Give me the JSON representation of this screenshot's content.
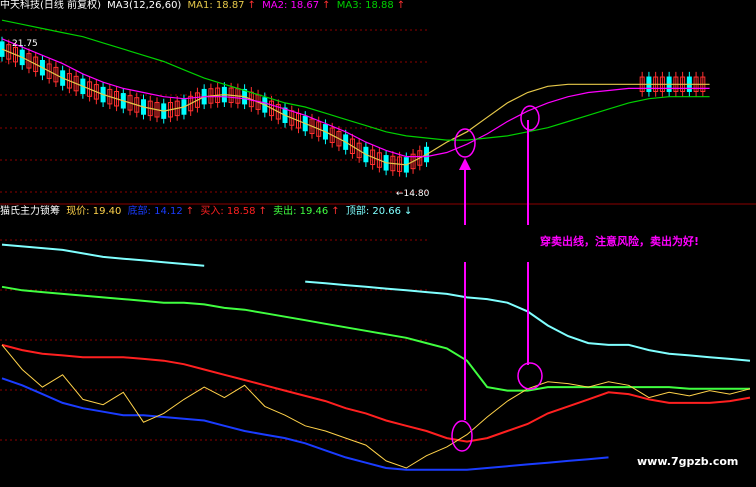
{
  "colors": {
    "bg": "#000000",
    "grid": "#8b0000",
    "up": "#ff3030",
    "down": "#00ffff",
    "ma1": "#e6c84a",
    "ma2": "#ff00ff",
    "ma3": "#00d000",
    "white": "#ffffff",
    "cyan": "#80ffff",
    "green": "#40ff40",
    "red": "#ff2020",
    "blue": "#1a3cff",
    "yellow": "#ffff40",
    "magenta": "#ff00ff",
    "orange": "#ffd24a"
  },
  "header_top": {
    "name": "中天科技(日线 前复权)",
    "ma3_label": "MA3(12,26,60)",
    "ma1": "MA1: 18.87",
    "ma2": "MA2: 18.67",
    "ma3": "MA3: 18.88",
    "arrow_up": "↑"
  },
  "header_bottom": {
    "title": "猫氏主力锁筹",
    "xianjia": "现价: 19.40",
    "dibu": "底部: 14.12",
    "mairu": "买入: 18.58",
    "maichu": "卖出: 19.46",
    "dingbu": "顶部: 20.66",
    "arrow_up": "↑",
    "arrow_down": "↓"
  },
  "annotations": {
    "high_label": "21.75",
    "low_label": "←14.80",
    "note": "穿卖出线，注意风险，卖出为好!",
    "watermark": "www.7gpzb.com"
  },
  "chart_data": [
    {
      "type": "line",
      "panel": "price",
      "x": [
        0,
        20,
        40,
        60,
        80,
        100,
        120,
        140,
        160,
        180,
        200,
        220,
        240,
        260,
        280,
        300,
        320,
        340,
        360,
        380,
        400,
        420,
        440,
        460,
        480,
        500,
        520,
        540,
        560,
        580,
        600,
        620,
        640,
        660,
        680,
        700
      ],
      "series": [
        {
          "name": "MA1",
          "values": [
            21.3,
            20.9,
            20.4,
            19.9,
            19.5,
            19.1,
            18.8,
            18.5,
            18.3,
            18.5,
            19.0,
            19.1,
            19.0,
            18.6,
            18.1,
            17.7,
            17.3,
            16.8,
            16.2,
            15.8,
            15.7,
            16.2,
            16.8,
            17.3,
            18.0,
            18.7,
            19.2,
            19.5,
            19.6,
            19.6,
            19.6,
            19.6,
            19.6,
            19.6,
            19.6,
            19.6
          ]
        },
        {
          "name": "MA2",
          "values": [
            21.8,
            21.4,
            21.0,
            20.6,
            20.1,
            19.7,
            19.4,
            19.2,
            19.0,
            18.9,
            19.0,
            19.0,
            18.9,
            18.7,
            18.4,
            18.1,
            17.7,
            17.3,
            16.8,
            16.4,
            16.1,
            16.1,
            16.3,
            16.7,
            17.2,
            17.8,
            18.3,
            18.7,
            19.0,
            19.2,
            19.3,
            19.4,
            19.4,
            19.4,
            19.4,
            19.4
          ]
        },
        {
          "name": "MA3",
          "values": [
            22.7,
            22.5,
            22.3,
            22.1,
            21.9,
            21.6,
            21.3,
            21.0,
            20.7,
            20.3,
            19.9,
            19.6,
            19.3,
            19.0,
            18.7,
            18.5,
            18.2,
            17.9,
            17.6,
            17.3,
            17.1,
            17.0,
            16.9,
            16.9,
            17.0,
            17.1,
            17.3,
            17.5,
            17.8,
            18.1,
            18.4,
            18.7,
            18.9,
            19.0,
            19.0,
            19.0
          ]
        }
      ],
      "ylim": [
        14,
        23
      ]
    },
    {
      "type": "line",
      "panel": "indicator",
      "x": [
        0,
        20,
        40,
        60,
        80,
        100,
        120,
        140,
        160,
        180,
        200,
        220,
        240,
        260,
        280,
        300,
        320,
        340,
        360,
        380,
        400,
        420,
        440,
        460,
        480,
        500,
        520,
        540,
        560,
        580,
        600,
        620,
        640,
        660,
        680,
        700,
        720,
        740
      ],
      "series": [
        {
          "name": "顶部",
          "values": [
            27.6,
            27.5,
            27.4,
            27.3,
            27.1,
            26.9,
            26.8,
            26.7,
            26.6,
            26.5,
            26.4,
            null,
            null,
            null,
            null,
            25.5,
            25.4,
            25.3,
            25.2,
            25.1,
            25.0,
            24.9,
            24.8,
            24.6,
            24.5,
            24.3,
            23.8,
            23.0,
            22.4,
            22.0,
            21.9,
            21.9,
            21.6,
            21.4,
            21.3,
            21.2,
            21.1,
            21.0
          ]
        },
        {
          "name": "卖出",
          "values": [
            25.2,
            25.0,
            24.9,
            24.8,
            24.7,
            24.6,
            24.5,
            24.4,
            24.3,
            24.3,
            24.2,
            24.0,
            23.9,
            23.7,
            23.5,
            23.3,
            23.1,
            22.9,
            22.7,
            22.5,
            22.3,
            22.0,
            21.7,
            21.0,
            19.5,
            19.3,
            19.3,
            19.5,
            19.5,
            19.5,
            19.5,
            19.5,
            19.5,
            19.5,
            19.4,
            19.4,
            19.4,
            19.4
          ]
        },
        {
          "name": "买入",
          "values": [
            21.9,
            21.6,
            21.4,
            21.3,
            21.2,
            21.2,
            21.2,
            21.1,
            21.0,
            20.8,
            20.5,
            20.2,
            19.9,
            19.6,
            19.3,
            19.0,
            18.7,
            18.3,
            18.0,
            17.6,
            17.3,
            17.0,
            16.6,
            16.4,
            16.6,
            17.0,
            17.4,
            18.0,
            18.4,
            18.8,
            19.2,
            19.1,
            18.8,
            18.6,
            18.6,
            18.6,
            18.7,
            18.9
          ]
        },
        {
          "name": "底部",
          "values": [
            20.0,
            19.6,
            19.1,
            18.6,
            18.3,
            18.1,
            17.9,
            17.9,
            17.8,
            17.7,
            17.6,
            17.3,
            17.0,
            16.8,
            16.6,
            16.3,
            15.9,
            15.5,
            15.2,
            14.9,
            14.8,
            14.8,
            14.8,
            14.8,
            14.9,
            15.0,
            15.1,
            15.2,
            15.3,
            15.4,
            15.5,
            null,
            null,
            null,
            null,
            null,
            null,
            null
          ]
        },
        {
          "name": "现价",
          "values": [
            21.9,
            20.5,
            19.5,
            20.2,
            18.8,
            18.5,
            19.2,
            17.5,
            18.0,
            18.8,
            19.5,
            18.9,
            19.6,
            18.4,
            17.9,
            17.3,
            17.0,
            16.6,
            16.2,
            15.3,
            14.9,
            15.6,
            16.1,
            16.8,
            17.8,
            18.7,
            19.4,
            19.8,
            19.7,
            19.5,
            19.8,
            19.6,
            18.9,
            19.2,
            19.0,
            19.3,
            19.1,
            19.4
          ]
        }
      ],
      "ylim": [
        14.5,
        29
      ]
    }
  ]
}
